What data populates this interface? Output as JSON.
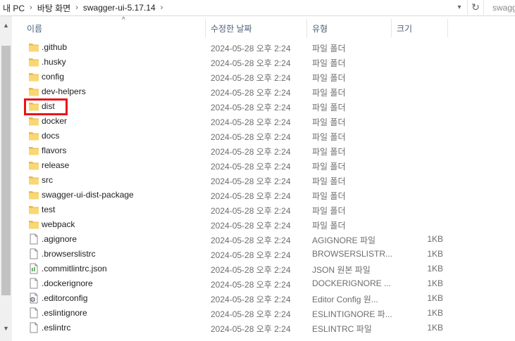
{
  "address": {
    "crumbs": [
      "내 PC",
      "바탕 화면",
      "swagger-ui-5.17.14"
    ],
    "search_text": "swagg"
  },
  "columns": {
    "name": "이름",
    "date": "수정한 날짜",
    "type": "유형",
    "size": "크기"
  },
  "files": [
    {
      "name": ".github",
      "date": "2024-05-28 오후 2:24",
      "type": "파일 폴더",
      "size": "",
      "icon": "folder-icon"
    },
    {
      "name": ".husky",
      "date": "2024-05-28 오후 2:24",
      "type": "파일 폴더",
      "size": "",
      "icon": "folder-icon"
    },
    {
      "name": "config",
      "date": "2024-05-28 오후 2:24",
      "type": "파일 폴더",
      "size": "",
      "icon": "folder-icon"
    },
    {
      "name": "dev-helpers",
      "date": "2024-05-28 오후 2:24",
      "type": "파일 폴더",
      "size": "",
      "icon": "folder-icon"
    },
    {
      "name": "dist",
      "date": "2024-05-28 오후 2:24",
      "type": "파일 폴더",
      "size": "",
      "icon": "folder-icon"
    },
    {
      "name": "docker",
      "date": "2024-05-28 오후 2:24",
      "type": "파일 폴더",
      "size": "",
      "icon": "folder-icon"
    },
    {
      "name": "docs",
      "date": "2024-05-28 오후 2:24",
      "type": "파일 폴더",
      "size": "",
      "icon": "folder-icon"
    },
    {
      "name": "flavors",
      "date": "2024-05-28 오후 2:24",
      "type": "파일 폴더",
      "size": "",
      "icon": "folder-icon"
    },
    {
      "name": "release",
      "date": "2024-05-28 오후 2:24",
      "type": "파일 폴더",
      "size": "",
      "icon": "folder-icon"
    },
    {
      "name": "src",
      "date": "2024-05-28 오후 2:24",
      "type": "파일 폴더",
      "size": "",
      "icon": "folder-icon"
    },
    {
      "name": "swagger-ui-dist-package",
      "date": "2024-05-28 오후 2:24",
      "type": "파일 폴더",
      "size": "",
      "icon": "folder-icon"
    },
    {
      "name": "test",
      "date": "2024-05-28 오후 2:24",
      "type": "파일 폴더",
      "size": "",
      "icon": "folder-icon"
    },
    {
      "name": "webpack",
      "date": "2024-05-28 오후 2:24",
      "type": "파일 폴더",
      "size": "",
      "icon": "folder-icon"
    },
    {
      "name": ".agignore",
      "date": "2024-05-28 오후 2:24",
      "type": "AGIGNORE 파일",
      "size": "1KB",
      "icon": "file-icon"
    },
    {
      "name": ".browserslistrc",
      "date": "2024-05-28 오후 2:24",
      "type": "BROWSERSLISTR...",
      "size": "1KB",
      "icon": "file-icon"
    },
    {
      "name": ".commitlintrc.json",
      "date": "2024-05-28 오후 2:24",
      "type": "JSON 원본 파일",
      "size": "1KB",
      "icon": "json-file-icon"
    },
    {
      "name": ".dockerignore",
      "date": "2024-05-28 오후 2:24",
      "type": "DOCKERIGNORE ...",
      "size": "1KB",
      "icon": "file-icon"
    },
    {
      "name": ".editorconfig",
      "date": "2024-05-28 오후 2:24",
      "type": "Editor Config 원...",
      "size": "1KB",
      "icon": "gear-file-icon"
    },
    {
      "name": ".eslintignore",
      "date": "2024-05-28 오후 2:24",
      "type": "ESLINTIGNORE 파...",
      "size": "1KB",
      "icon": "file-icon"
    },
    {
      "name": ".eslintrc",
      "date": "2024-05-28 오후 2:24",
      "type": "ESLINTRC 파일",
      "size": "1KB",
      "icon": "file-icon"
    }
  ],
  "highlighted_item": "dist",
  "colors": {
    "highlight": "#e8141a",
    "folder": "#f8d775",
    "column_header_text": "#4c607a"
  }
}
